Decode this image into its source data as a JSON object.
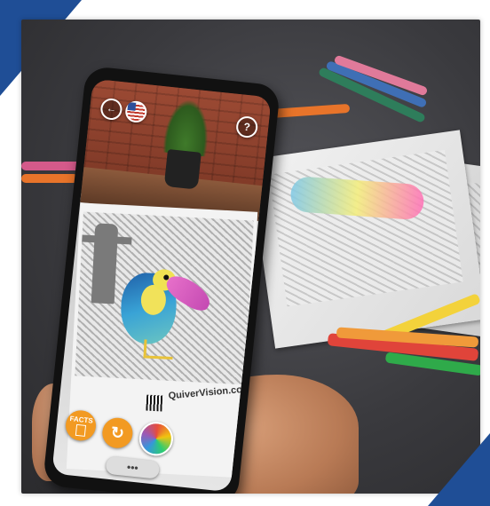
{
  "image": {
    "subject": "hand holding smartphone showing augmented-reality toucan on coloring page",
    "colors": {
      "accent_corner": "#1f4e96",
      "background": "#ffffff",
      "ui_button": "#f29a22"
    }
  },
  "phone_ui": {
    "page_text": "QuiverVision.com",
    "facts_label": "FACTS",
    "more_label": "•••",
    "icons": [
      "back-icon",
      "us-flag-icon",
      "help-icon",
      "facts-icon",
      "refresh-icon",
      "color-wheel-icon",
      "more-icon"
    ]
  }
}
